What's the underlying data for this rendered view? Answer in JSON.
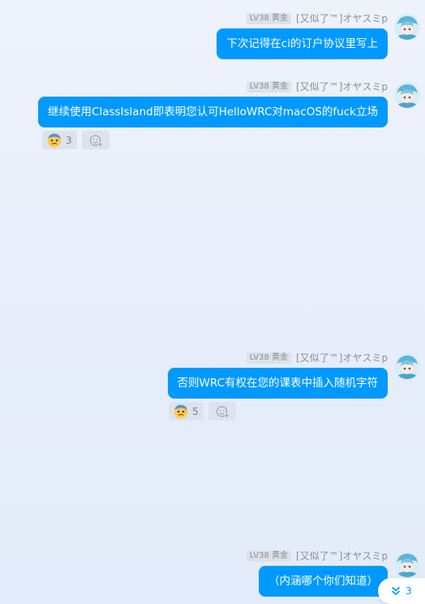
{
  "colors": {
    "bubble": "#0099ff",
    "bubble_text": "#ffffff",
    "meta_text": "#8a8f99",
    "accent": "#0099ff"
  },
  "messages": [
    {
      "level": "LV38 黄金",
      "nickname": "[又似了™]オヤスミp",
      "text": "下次记得在ci的订户协议里写上",
      "reactions": []
    },
    {
      "level": "LV38 黄金",
      "nickname": "[又似了™]オヤスミp",
      "text": "继续使用ClassIsland即表明您认可HelloWRC对macOS的fuck立场",
      "reactions": [
        {
          "icon": "anxious-face-with-sweat-emoji",
          "count": "3"
        }
      ]
    },
    {
      "level": "LV38 黄金",
      "nickname": "[又似了™]オヤスミp",
      "text": "否则WRC有权在您的课表中插入随机字符",
      "reactions": [
        {
          "icon": "anxious-face-with-sweat-emoji",
          "count": "5"
        }
      ]
    },
    {
      "level": "LV38 黄金",
      "nickname": "[又似了™]オヤスミp",
      "text": "（内涵哪个你们知道）",
      "reactions": []
    }
  ],
  "jump_to_new": {
    "icon": "double-chevron-down-icon",
    "count": "3"
  }
}
